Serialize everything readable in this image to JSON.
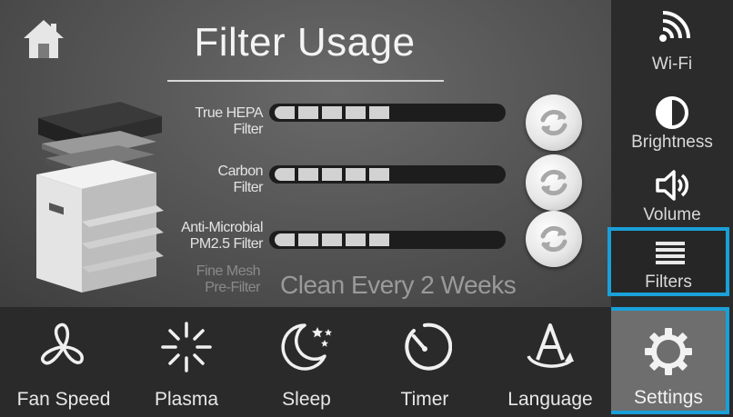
{
  "header": {
    "title": "Filter Usage",
    "home_icon": "home-icon"
  },
  "filters": [
    {
      "label_line1": "True HEPA",
      "label_line2": "Filter",
      "level": 0.5,
      "segments_total": 10,
      "segments_filled": 5
    },
    {
      "label_line1": "Carbon",
      "label_line2": "Filter",
      "level": 0.5,
      "segments_total": 10,
      "segments_filled": 5
    },
    {
      "label_line1": "Anti-Microbial",
      "label_line2": "PM2.5 Filter",
      "level": 0.5,
      "segments_total": 10,
      "segments_filled": 5
    }
  ],
  "prefilter": {
    "label_line1": "Fine Mesh",
    "label_line2": "Pre-Filter",
    "note": "Clean Every 2 Weeks"
  },
  "sidebar": {
    "items": [
      {
        "label": "Wi-Fi",
        "icon": "wifi-icon"
      },
      {
        "label": "Brightness",
        "icon": "brightness-icon"
      },
      {
        "label": "Volume",
        "icon": "volume-icon"
      },
      {
        "label": "Filters",
        "icon": "filters-icon",
        "selected": true
      },
      {
        "label": "Settings",
        "icon": "gear-icon",
        "selected": true
      }
    ]
  },
  "bottom_bar": {
    "items": [
      {
        "label": "Fan Speed",
        "icon": "fan-icon"
      },
      {
        "label": "Plasma",
        "icon": "plasma-icon"
      },
      {
        "label": "Sleep",
        "icon": "sleep-icon"
      },
      {
        "label": "Timer",
        "icon": "timer-icon"
      },
      {
        "label": "Language",
        "icon": "language-icon"
      }
    ]
  },
  "colors": {
    "accent": "#1aa0d8",
    "bar_fill": "#d2d2d2",
    "bar_track": "#1d1d1d"
  }
}
